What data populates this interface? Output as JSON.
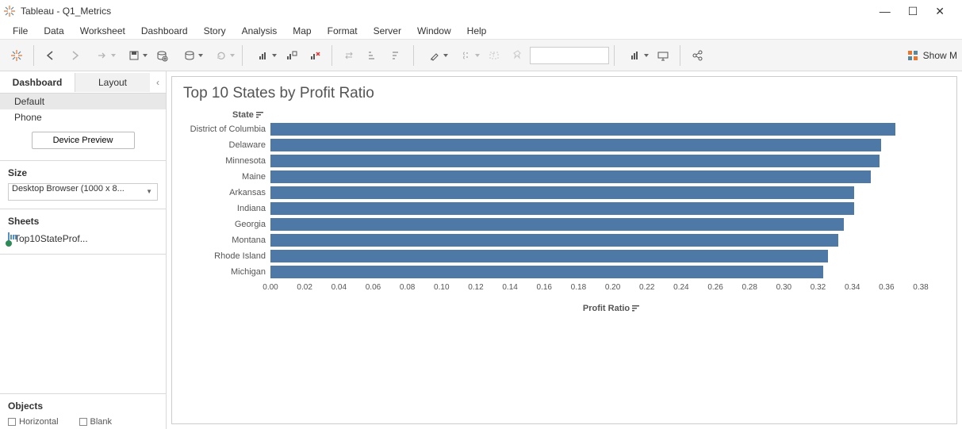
{
  "window": {
    "app": "Tableau",
    "file": "Q1_Metrics"
  },
  "menu": [
    "File",
    "Data",
    "Worksheet",
    "Dashboard",
    "Story",
    "Analysis",
    "Map",
    "Format",
    "Server",
    "Window",
    "Help"
  ],
  "toolbar": {
    "shelf_value": "",
    "showme": "Show M"
  },
  "sidebar": {
    "tabs": {
      "dashboard": "Dashboard",
      "layout": "Layout"
    },
    "devices": {
      "default": "Default",
      "phone": "Phone",
      "preview_btn": "Device Preview"
    },
    "size": {
      "title": "Size",
      "value": "Desktop Browser (1000 x 8..."
    },
    "sheets": {
      "title": "Sheets",
      "items": [
        "Top10StateProf..."
      ]
    },
    "objects": {
      "title": "Objects",
      "items": [
        "Horizontal",
        "Blank"
      ]
    }
  },
  "viz": {
    "title": "Top 10 States by Profit Ratio",
    "y_axis_title": "State",
    "x_axis_title": "Profit Ratio"
  },
  "chart_data": {
    "type": "bar",
    "orientation": "horizontal",
    "title": "Top 10 States by Profit Ratio",
    "xlabel": "Profit Ratio",
    "ylabel": "State",
    "xlim": [
      0,
      0.38
    ],
    "xticks": [
      0.0,
      0.02,
      0.04,
      0.06,
      0.08,
      0.1,
      0.12,
      0.14,
      0.16,
      0.18,
      0.2,
      0.22,
      0.24,
      0.26,
      0.28,
      0.3,
      0.32,
      0.34,
      0.36,
      0.38
    ],
    "categories": [
      "District of Columbia",
      "Delaware",
      "Minnesota",
      "Maine",
      "Arkansas",
      "Indiana",
      "Georgia",
      "Montana",
      "Rhode Island",
      "Michigan"
    ],
    "values": [
      0.365,
      0.357,
      0.356,
      0.351,
      0.341,
      0.341,
      0.335,
      0.332,
      0.326,
      0.323
    ],
    "color": "#4e79a7"
  }
}
